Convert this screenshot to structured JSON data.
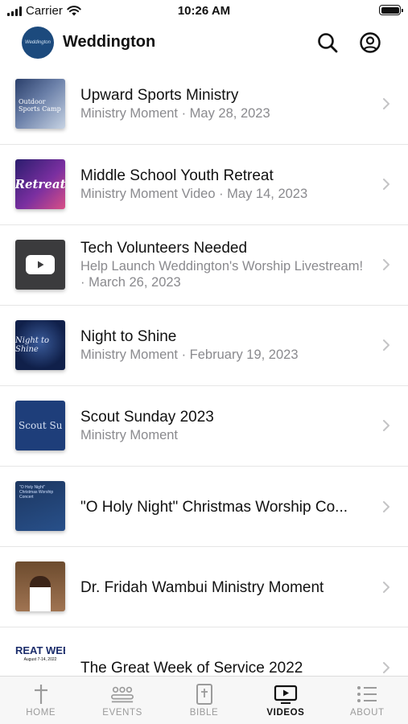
{
  "status_bar": {
    "carrier": "Carrier",
    "time": "10:26 AM"
  },
  "header": {
    "title": "Weddington",
    "logo_text": "Weddington"
  },
  "videos": [
    {
      "title": "Upward Sports Ministry",
      "subtitle": "Ministry Moment · May 28, 2023",
      "thumbnail_text": "Outdoor Sports Camp"
    },
    {
      "title": "Middle School Youth Retreat",
      "subtitle": "Ministry Moment Video · May 14, 2023",
      "thumbnail_text": "Retreat"
    },
    {
      "title": "Tech Volunteers Needed",
      "subtitle": "Help Launch Weddington's Worship Livestream! · March 26, 2023",
      "thumbnail_icon": "youtube-play-icon"
    },
    {
      "title": "Night to Shine",
      "subtitle": "Ministry Moment · February 19, 2023",
      "thumbnail_text": "Night to Shine"
    },
    {
      "title": "Scout Sunday 2023",
      "subtitle": "Ministry Moment",
      "thumbnail_text": "Scout Su"
    },
    {
      "title": "\"O Holy Night\" Christmas Worship Co...",
      "subtitle": "",
      "thumbnail_text": "\"O Holy Night\" Christmas Worship Concert"
    },
    {
      "title": "Dr. Fridah Wambui Ministry Moment",
      "subtitle": ""
    },
    {
      "title": "The Great Week of Service 2022",
      "subtitle": "",
      "thumbnail_text": "REAT WEEK",
      "thumbnail_date": "August 7-14, 2022"
    }
  ],
  "tab_bar": {
    "tabs": [
      {
        "label": "HOME",
        "icon": "cross-icon",
        "active": false
      },
      {
        "label": "EVENTS",
        "icon": "people-icon",
        "active": false
      },
      {
        "label": "BIBLE",
        "icon": "bible-icon",
        "active": false
      },
      {
        "label": "VIDEOS",
        "icon": "video-play-icon",
        "active": true
      },
      {
        "label": "ABOUT",
        "icon": "list-icon",
        "active": false
      }
    ]
  },
  "colors": {
    "brand": "#1c4a7d",
    "subtitle_gray": "#8a8a8e",
    "tab_inactive": "#9b9b9b",
    "tab_active": "#111111"
  }
}
